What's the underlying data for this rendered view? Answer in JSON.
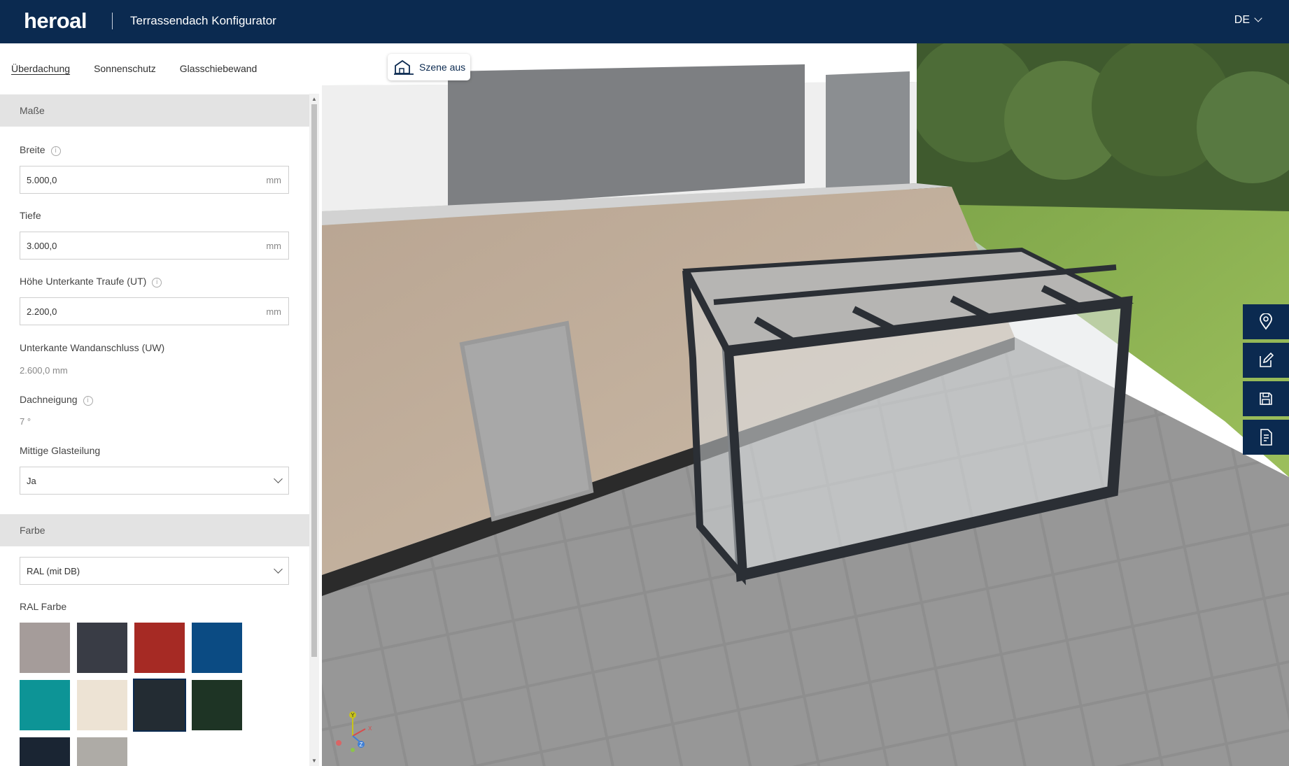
{
  "header": {
    "logo": "heroal",
    "title": "Terrassendach Konfigurator",
    "language": "DE"
  },
  "tabs": [
    "Überdachung",
    "Sonnenschutz",
    "Glasschiebewand"
  ],
  "masse": {
    "section_title": "Maße",
    "breite": {
      "label": "Breite",
      "value": "5.000,0",
      "unit": "mm"
    },
    "tiefe": {
      "label": "Tiefe",
      "value": "3.000,0",
      "unit": "mm"
    },
    "hoehe_ut": {
      "label": "Höhe Unterkante Traufe (UT)",
      "value": "2.200,0",
      "unit": "mm"
    },
    "unterkante_uw": {
      "label": "Unterkante Wandanschluss (UW)",
      "value": "2.600,0 mm"
    },
    "dachneigung": {
      "label": "Dachneigung",
      "value": "7 °"
    },
    "glasteilung": {
      "label": "Mittige Glasteilung",
      "value": "Ja"
    }
  },
  "farbe": {
    "section_title": "Farbe",
    "type": "RAL (mit DB)",
    "ral_label": "RAL Farbe",
    "swatch_colors": [
      "#a59c9a",
      "#393c45",
      "#a62a24",
      "#0b4b83",
      "#0d9496",
      "#ede3d4",
      "#232c33",
      "#1e3425",
      "#1a2533",
      "#aeaba6"
    ],
    "selected_index": 6
  },
  "viewport": {
    "scene_button": "Szene aus",
    "side_tools": [
      "location-icon",
      "edit-icon",
      "save-icon",
      "document-icon"
    ],
    "axis_labels": [
      "Y",
      "X",
      "Z"
    ]
  }
}
